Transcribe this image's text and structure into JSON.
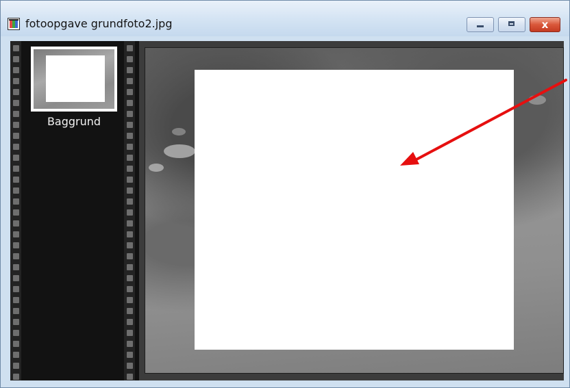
{
  "window": {
    "title": "fotoopgave grundfoto2.jpg",
    "icon": "image-file-icon",
    "controls": {
      "minimize_icon": "minimize-icon",
      "maximize_icon": "maximize-icon",
      "close_icon": "close-icon",
      "close_glyph": "x"
    }
  },
  "layers_panel": {
    "items": [
      {
        "label": "Baggrund",
        "thumbnail": "layer-thumbnail"
      }
    ]
  },
  "annotation": {
    "arrow_color": "#e60f0f"
  },
  "colors": {
    "titlebar": "#d3e3f3",
    "filmstrip": "#121212",
    "close_button": "#d9573a"
  }
}
